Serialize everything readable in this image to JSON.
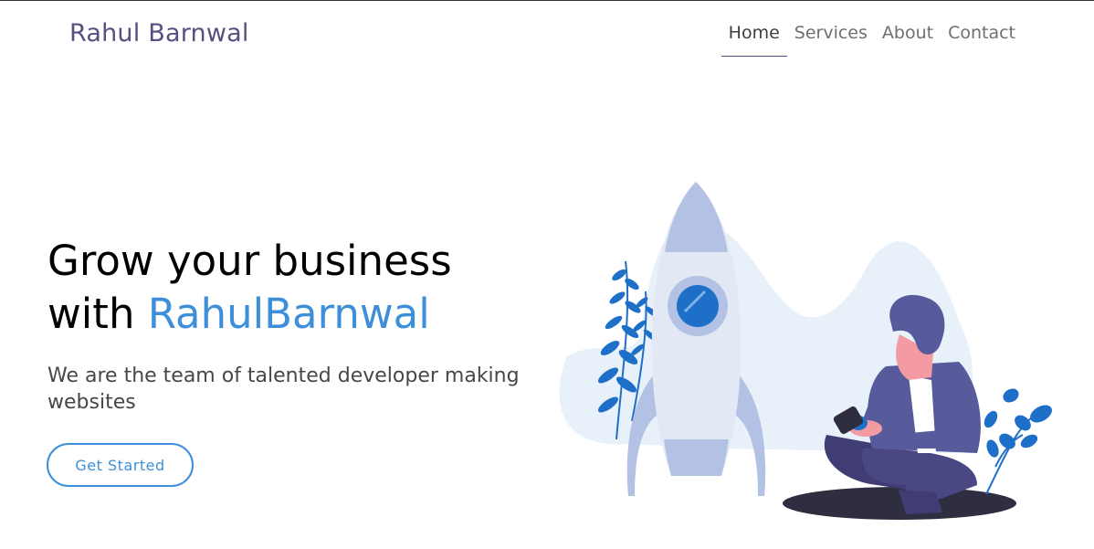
{
  "brand": {
    "name": "Rahul Barnwal"
  },
  "nav": {
    "items": [
      {
        "label": "Home",
        "active": true
      },
      {
        "label": "Services",
        "active": false
      },
      {
        "label": "About",
        "active": false
      },
      {
        "label": "Contact",
        "active": false
      }
    ]
  },
  "hero": {
    "title_line1": "Grow your business",
    "title_line2_prefix": "with ",
    "title_line2_accent": "RahulBarnwal",
    "subtitle": "We are the team of talented developer making websites",
    "cta_label": "Get Started"
  },
  "colors": {
    "brand": "#55507f",
    "accent": "#3d8fd9",
    "text": "#474747"
  },
  "illustration": {
    "icons": [
      "rocket-icon",
      "person-with-phone-icon",
      "plant-icon"
    ]
  }
}
